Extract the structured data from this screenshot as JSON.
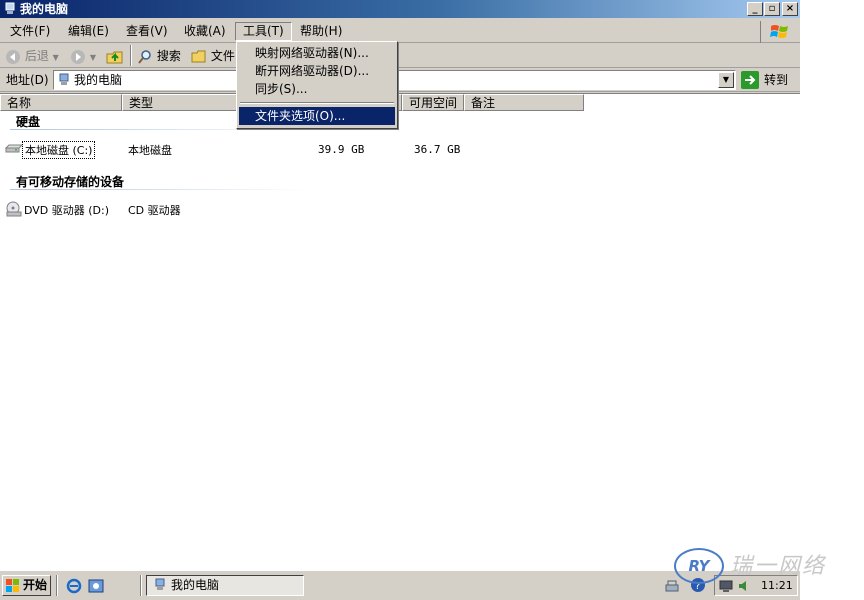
{
  "window": {
    "title": "我的电脑",
    "controls": {
      "minimize": "_",
      "restore": "▫",
      "close": "×"
    }
  },
  "menubar": {
    "items": [
      {
        "label": "文件(F)"
      },
      {
        "label": "编辑(E)"
      },
      {
        "label": "查看(V)"
      },
      {
        "label": "收藏(A)"
      },
      {
        "label": "工具(T)",
        "active": true
      },
      {
        "label": "帮助(H)"
      }
    ]
  },
  "toolbar": {
    "back": "后退",
    "search": "搜索",
    "folders": "文件"
  },
  "address": {
    "label": "地址(D)",
    "value": "我的电脑",
    "go": "转到"
  },
  "columns": [
    "名称",
    "类型",
    "可用空间",
    "备注"
  ],
  "groups": [
    {
      "title": "硬盘",
      "items": [
        {
          "name": "本地磁盘 (C:)",
          "type": "本地磁盘",
          "total": "39.9 GB",
          "free": "36.7 GB",
          "selected": true
        }
      ]
    },
    {
      "title": "有可移动存储的设备",
      "items": [
        {
          "name": "DVD 驱动器 (D:)",
          "type": "CD 驱动器"
        }
      ]
    }
  ],
  "tools_menu": {
    "items": [
      {
        "label": "映射网络驱动器(N)..."
      },
      {
        "label": "断开网络驱动器(D)..."
      },
      {
        "label": "同步(S)..."
      },
      {
        "label": "文件夹选项(O)...",
        "highlighted": true
      }
    ]
  },
  "taskbar": {
    "start": "开始",
    "task": "我的电脑",
    "clock": "11:21"
  },
  "watermark": {
    "logo": "RY",
    "text": "瑞一网络"
  },
  "colors": {
    "title_gradient_start": "#0a246a",
    "menu_highlight": "#0a246a",
    "chrome": "#d4d0c8"
  }
}
